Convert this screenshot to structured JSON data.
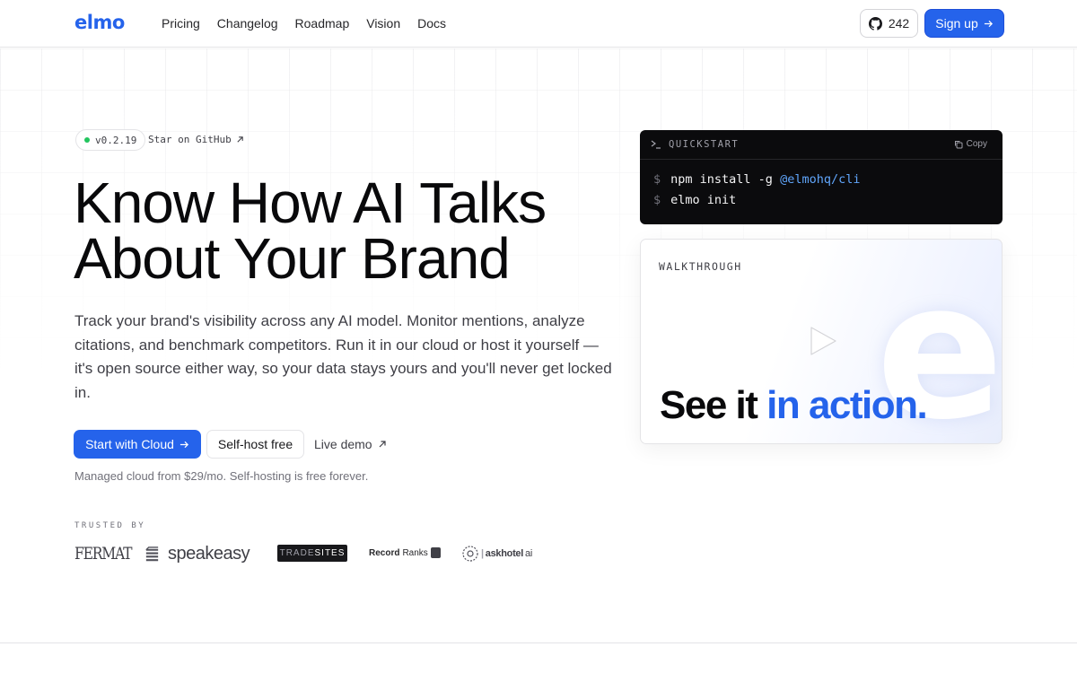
{
  "header": {
    "logo": "elmo",
    "nav": [
      "Pricing",
      "Changelog",
      "Roadmap",
      "Vision",
      "Docs"
    ],
    "github_stars": "242",
    "signup_label": "Sign up"
  },
  "hero": {
    "version": "v0.2.19",
    "star_link": "Star on GitHub",
    "title_line1": "Know How AI Talks",
    "title_line2": "About Your Brand",
    "description": "Track your brand's visibility across any AI model. Monitor mentions, analyze citations, and benchmark competitors. Run it in our cloud or host it yourself — it's open source either way, so your data stays yours and you'll never get locked in.",
    "cta_primary": "Start with Cloud",
    "cta_secondary": "Self-host free",
    "cta_demo": "Live demo",
    "pricing_note": "Managed cloud from $29/mo. Self-hosting is free forever."
  },
  "trusted": {
    "label": "TRUSTED BY",
    "logos": {
      "fermat": "FERMAT",
      "speakeasy": "speakeasy",
      "tradesites_a": "TRADE",
      "tradesites_b": "SITES",
      "recordranks_a": "Record",
      "recordranks_b": "Ranks",
      "askhotel": "askhotel",
      "askhotel_ai": "ai"
    }
  },
  "quickstart": {
    "title": "QUICKSTART",
    "copy_label": "Copy",
    "prompt": "$",
    "line1_cmd": "npm install -g",
    "line1_pkg": "@elmohq/cli",
    "line2_cmd": "elmo init"
  },
  "walkthrough": {
    "label": "WALKTHROUGH",
    "caption_a": "See it",
    "caption_b": "in action.",
    "watermark": "e"
  },
  "colors": {
    "accent": "#2563eb",
    "terminal_bg": "#0b0b0d",
    "status_dot": "#22c55e"
  },
  "icons": [
    "github-icon",
    "arrow-right-icon",
    "external-arrow-icon",
    "terminal-icon",
    "copy-icon",
    "play-icon"
  ]
}
